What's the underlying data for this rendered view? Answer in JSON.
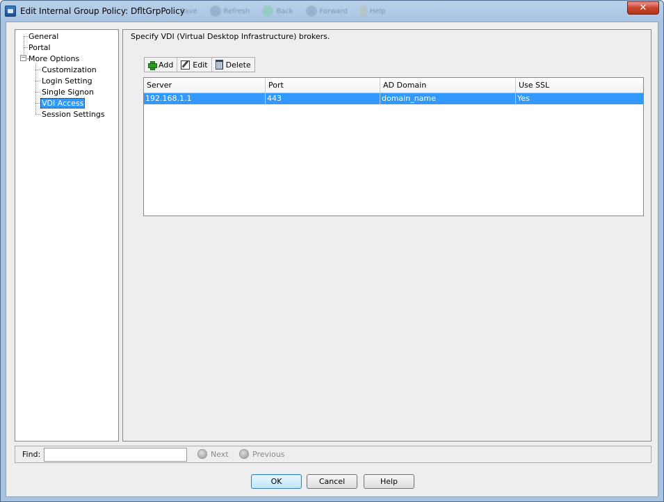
{
  "window": {
    "title": "Edit Internal Group Policy: DfltGrpPolicy",
    "close_label": "✕",
    "background_toolbar": [
      "Save",
      "Refresh",
      "Back",
      "Forward",
      "Help"
    ]
  },
  "tree": {
    "items": [
      {
        "label": "General"
      },
      {
        "label": "Portal"
      },
      {
        "label": "More Options"
      },
      {
        "label": "Customization"
      },
      {
        "label": "Login Setting"
      },
      {
        "label": "Single Signon"
      },
      {
        "label": "VDI Access"
      },
      {
        "label": "Session Settings"
      }
    ],
    "expander_label": "−",
    "selected": "VDI Access"
  },
  "content": {
    "description": "Specify VDI (Virtual Desktop Infrastructure) brokers.",
    "toolbar": {
      "add_label": "Add",
      "edit_label": "Edit",
      "delete_label": "Delete"
    },
    "table": {
      "columns": [
        "Server",
        "Port",
        "AD Domain",
        "Use SSL"
      ],
      "rows": [
        [
          "192.168.1.1",
          "443",
          "domain_name",
          "Yes"
        ]
      ],
      "selected_row": 0
    }
  },
  "find": {
    "label": "Find:",
    "value": "",
    "next_label": "Next",
    "previous_label": "Previous"
  },
  "buttons": {
    "ok": "OK",
    "cancel": "Cancel",
    "help": "Help"
  },
  "colors": {
    "selection": "#3399ff",
    "close_button": "#c8442c",
    "title_bar": "#a9c4e3"
  }
}
